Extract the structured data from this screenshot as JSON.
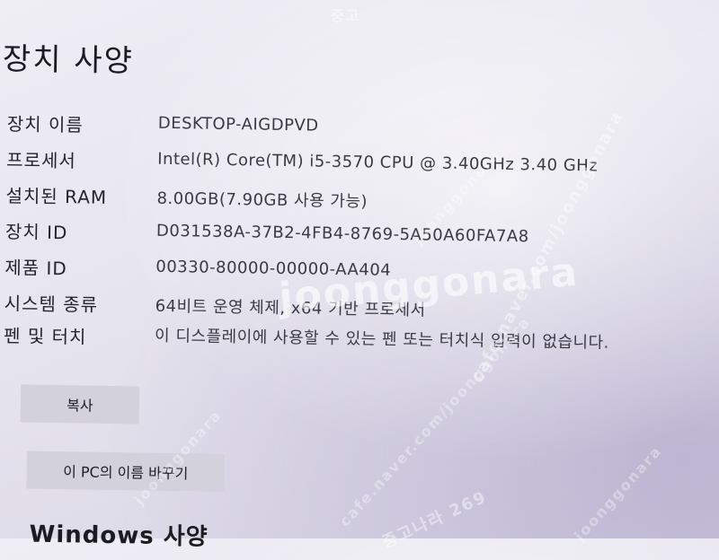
{
  "page_title": "장치 사양",
  "specs": [
    {
      "label": "장치 이름",
      "value": "DESKTOP-AIGDPVD"
    },
    {
      "label": "프로세서",
      "value": "Intel(R) Core(TM) i5-3570 CPU @ 3.40GHz   3.40 GHz"
    },
    {
      "label": "설치된 RAM",
      "value": "8.00GB(7.90GB 사용 가능)"
    },
    {
      "label": "장치 ID",
      "value": "D031538A-37B2-4FB4-8769-5A50A60FA7A8"
    },
    {
      "label": "제품 ID",
      "value": "00330-80000-00000-AA404"
    },
    {
      "label": "시스템 종류",
      "value": "64비트 운영 체제, x64 기반 프로세서"
    },
    {
      "label": "펜 및 터치",
      "value": "이 디스플레이에 사용할 수 있는 펜 또는 터치식 입력이 없습니다."
    }
  ],
  "buttons": {
    "copy": "복사",
    "rename_pc": "이 PC의 이름 바꾸기"
  },
  "next_section": "Windows 사양",
  "watermarks": {
    "main": "joonggonara",
    "cafe": "cafe.naver.com/joonggonara",
    "top": "중고",
    "bottom": "중고나라 269"
  }
}
